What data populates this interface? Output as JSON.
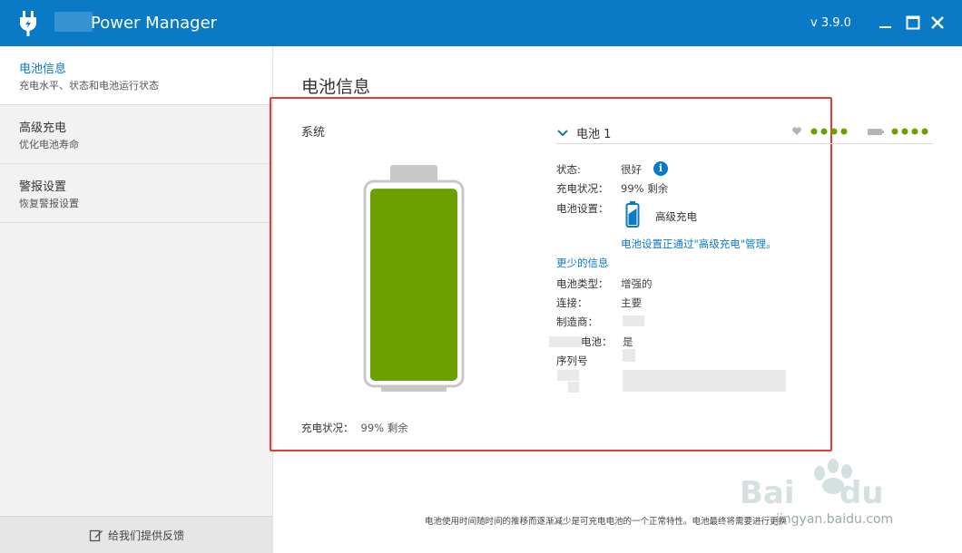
{
  "window": {
    "title": "Power Manager",
    "version": "v 3.9.0"
  },
  "sidebar": {
    "items": [
      {
        "title": "电池信息",
        "subtitle": "充电水平、状态和电池运行状态"
      },
      {
        "title": "高级充电",
        "subtitle": "优化电池寿命"
      },
      {
        "title": "警报设置",
        "subtitle": "恢复警报设置"
      }
    ],
    "feedback": "给我们提供反馈"
  },
  "main": {
    "title": "电池信息",
    "system_label": "系统",
    "bottom_status": {
      "label": "充电状况：",
      "value": "99% 剩余"
    },
    "battery_level": 0.99,
    "battery": {
      "name": "电池 1",
      "status_label": "状态:",
      "status_value": "很好",
      "charge_label": "充电状况：",
      "charge_value": "99% 剩余",
      "settings_label": "电池设置：",
      "settings_mode": "高级充电",
      "settings_note": "电池设置正通过\"高级充电\"管理。",
      "less_info": "更少的信息",
      "type_label": "电池类型：",
      "type_value": "增强的",
      "connection_label": "连接：",
      "connection_value": "主要",
      "manufacturer_label": "制造商：",
      "certified_label": "电池：",
      "certified_value": "是",
      "serial_label": "序列号"
    },
    "footnote": "电池使用时间随时间的推移而逐渐减少是可充电电池的一个正常特性。电池最终将需要进行更换"
  },
  "watermark": {
    "text": "jingyan.baidu.com"
  },
  "colors": {
    "accent": "#0a7ac7",
    "battery_fill": "#6aa000",
    "dots_green": "#6aa000",
    "highlight": "#e43b3b"
  }
}
